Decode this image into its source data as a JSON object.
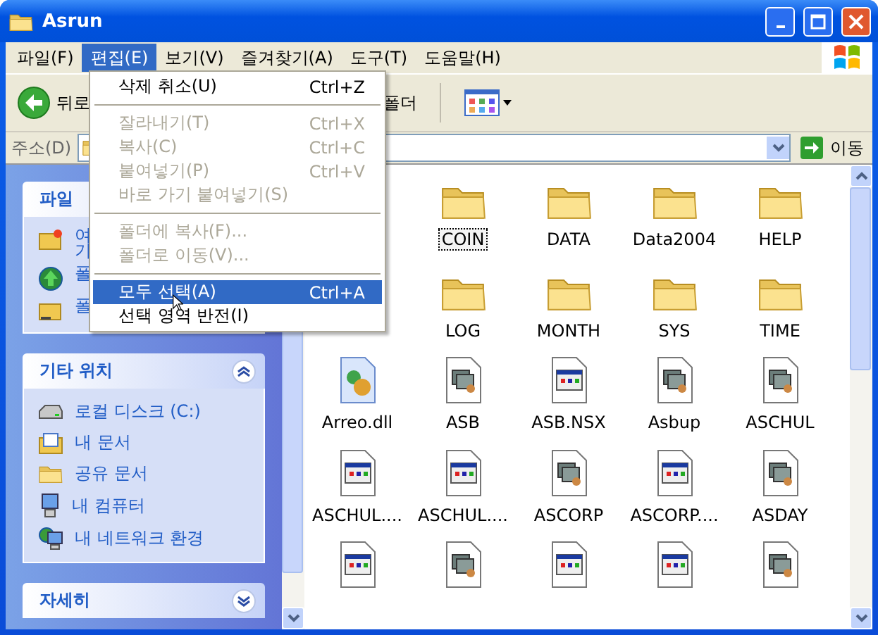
{
  "window": {
    "title": "Asrun"
  },
  "menu_bar": [
    {
      "label": "파일(F)",
      "selected": false
    },
    {
      "label": "편집(E)",
      "selected": true
    },
    {
      "label": "보기(V)",
      "selected": false
    },
    {
      "label": "즐겨찾기(A)",
      "selected": false
    },
    {
      "label": "도구(T)",
      "selected": false
    },
    {
      "label": "도움말(H)",
      "selected": false
    }
  ],
  "edit_menu": [
    {
      "kind": "item",
      "label": "삭제 취소(U)",
      "shortcut": "Ctrl+Z",
      "disabled": false,
      "selected": false
    },
    {
      "kind": "separator"
    },
    {
      "kind": "item",
      "label": "잘라내기(T)",
      "shortcut": "Ctrl+X",
      "disabled": true,
      "selected": false
    },
    {
      "kind": "item",
      "label": "복사(C)",
      "shortcut": "Ctrl+C",
      "disabled": true,
      "selected": false
    },
    {
      "kind": "item",
      "label": "붙여넣기(P)",
      "shortcut": "Ctrl+V",
      "disabled": true,
      "selected": false
    },
    {
      "kind": "item",
      "label": "바로 가기 붙여넣기(S)",
      "disabled": true,
      "selected": false
    },
    {
      "kind": "separator"
    },
    {
      "kind": "item",
      "label": "폴더에 복사(F)...",
      "disabled": true,
      "selected": false
    },
    {
      "kind": "item",
      "label": "폴더로 이동(V)...",
      "disabled": true,
      "selected": false
    },
    {
      "kind": "separator"
    },
    {
      "kind": "item",
      "label": "모두 선택(A)",
      "shortcut": "Ctrl+A",
      "disabled": false,
      "selected": true
    },
    {
      "kind": "item",
      "label": "선택 영역 반전(I)",
      "disabled": false,
      "selected": false
    }
  ],
  "toolbar": {
    "back": "뒤로",
    "folders": "폴더"
  },
  "address_bar": {
    "label": "주소(D)",
    "go": "이동"
  },
  "task_pane": {
    "file_tasks": {
      "title": "파일",
      "items": [
        {
          "lines": [
            "여",
            "기"
          ],
          "kind": "folder-star"
        },
        {
          "lines": [
            "폴"
          ],
          "kind": "globe"
        },
        {
          "lines": [
            "폴"
          ],
          "kind": "folder-share"
        }
      ]
    },
    "other_places": {
      "title": "기타 위치",
      "expanded": true,
      "items": [
        {
          "label": "로컬 디스크 (C:)",
          "kind": "drive"
        },
        {
          "label": "내 문서",
          "kind": "documents"
        },
        {
          "label": "공유 문서",
          "kind": "folder"
        },
        {
          "label": "내 컴퓨터",
          "kind": "computer"
        },
        {
          "label": "내 네트워크 환경",
          "kind": "network"
        }
      ]
    },
    "details": {
      "title": "자세히",
      "expanded": false
    }
  },
  "file_rows": [
    [
      {
        "name": "COIN",
        "kind": "folder",
        "focused": true
      },
      {
        "name": "DATA",
        "kind": "folder",
        "focused": false
      },
      {
        "name": "Data2004",
        "kind": "folder",
        "focused": false
      },
      {
        "name": "HELP",
        "kind": "folder",
        "focused": false
      }
    ],
    [
      {
        "name": "LOG",
        "kind": "folder",
        "focused": false
      },
      {
        "name": "MONTH",
        "kind": "folder",
        "focused": false
      },
      {
        "name": "SYS",
        "kind": "folder",
        "focused": false
      },
      {
        "name": "TIME",
        "kind": "folder",
        "focused": false
      }
    ],
    [
      {
        "name": "Arreo.dll",
        "kind": "dll",
        "focused": false
      },
      {
        "name": "ASB",
        "kind": "program",
        "focused": false
      },
      {
        "name": "ASB.NSX",
        "kind": "document",
        "focused": false
      },
      {
        "name": "Asbup",
        "kind": "program",
        "focused": false
      },
      {
        "name": "ASCHUL",
        "kind": "program",
        "focused": false
      }
    ],
    [
      {
        "name": "ASCHUL....",
        "kind": "document",
        "focused": false
      },
      {
        "name": "ASCHUL....",
        "kind": "document",
        "focused": false
      },
      {
        "name": "ASCORP",
        "kind": "program",
        "focused": false
      },
      {
        "name": "ASCORP....",
        "kind": "document",
        "focused": false
      },
      {
        "name": "ASDAY",
        "kind": "program",
        "focused": false
      }
    ],
    [
      {
        "kind": "document"
      },
      {
        "kind": "program"
      },
      {
        "kind": "document"
      },
      {
        "kind": "document"
      },
      {
        "kind": "program"
      }
    ]
  ]
}
